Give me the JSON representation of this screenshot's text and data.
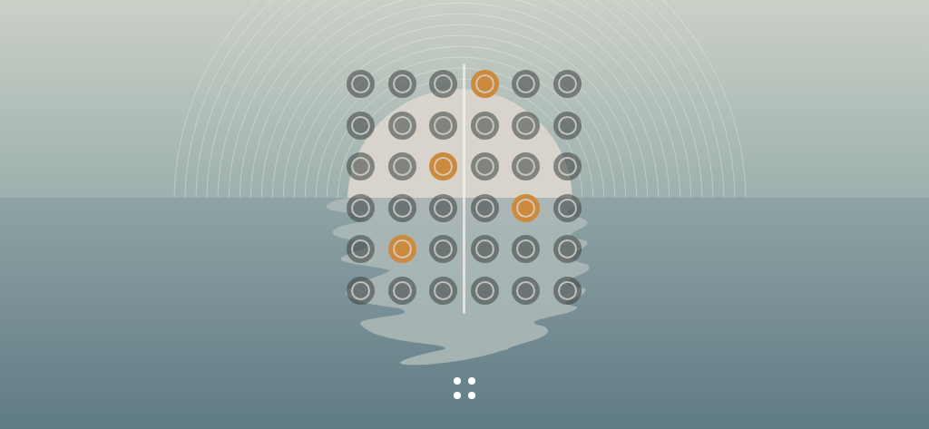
{
  "grid": {
    "rows": [
      {
        "cells": [
          {
            "selected": false
          },
          {
            "selected": false
          },
          {
            "selected": false
          },
          {
            "selected": true
          },
          {
            "selected": false
          },
          {
            "selected": false
          }
        ]
      },
      {
        "cells": [
          {
            "selected": false
          },
          {
            "selected": false
          },
          {
            "selected": false
          },
          {
            "selected": false
          },
          {
            "selected": false
          },
          {
            "selected": false
          }
        ]
      },
      {
        "cells": [
          {
            "selected": false
          },
          {
            "selected": false
          },
          {
            "selected": true
          },
          {
            "selected": false
          },
          {
            "selected": false
          },
          {
            "selected": false
          }
        ]
      },
      {
        "cells": [
          {
            "selected": false
          },
          {
            "selected": false
          },
          {
            "selected": false
          },
          {
            "selected": false
          },
          {
            "selected": true
          },
          {
            "selected": false
          }
        ]
      },
      {
        "cells": [
          {
            "selected": false
          },
          {
            "selected": true
          },
          {
            "selected": false
          },
          {
            "selected": false
          },
          {
            "selected": false
          },
          {
            "selected": false
          }
        ]
      },
      {
        "cells": [
          {
            "selected": false
          },
          {
            "selected": false
          },
          {
            "selected": false
          },
          {
            "selected": false
          },
          {
            "selected": false
          },
          {
            "selected": false
          }
        ]
      }
    ]
  }
}
